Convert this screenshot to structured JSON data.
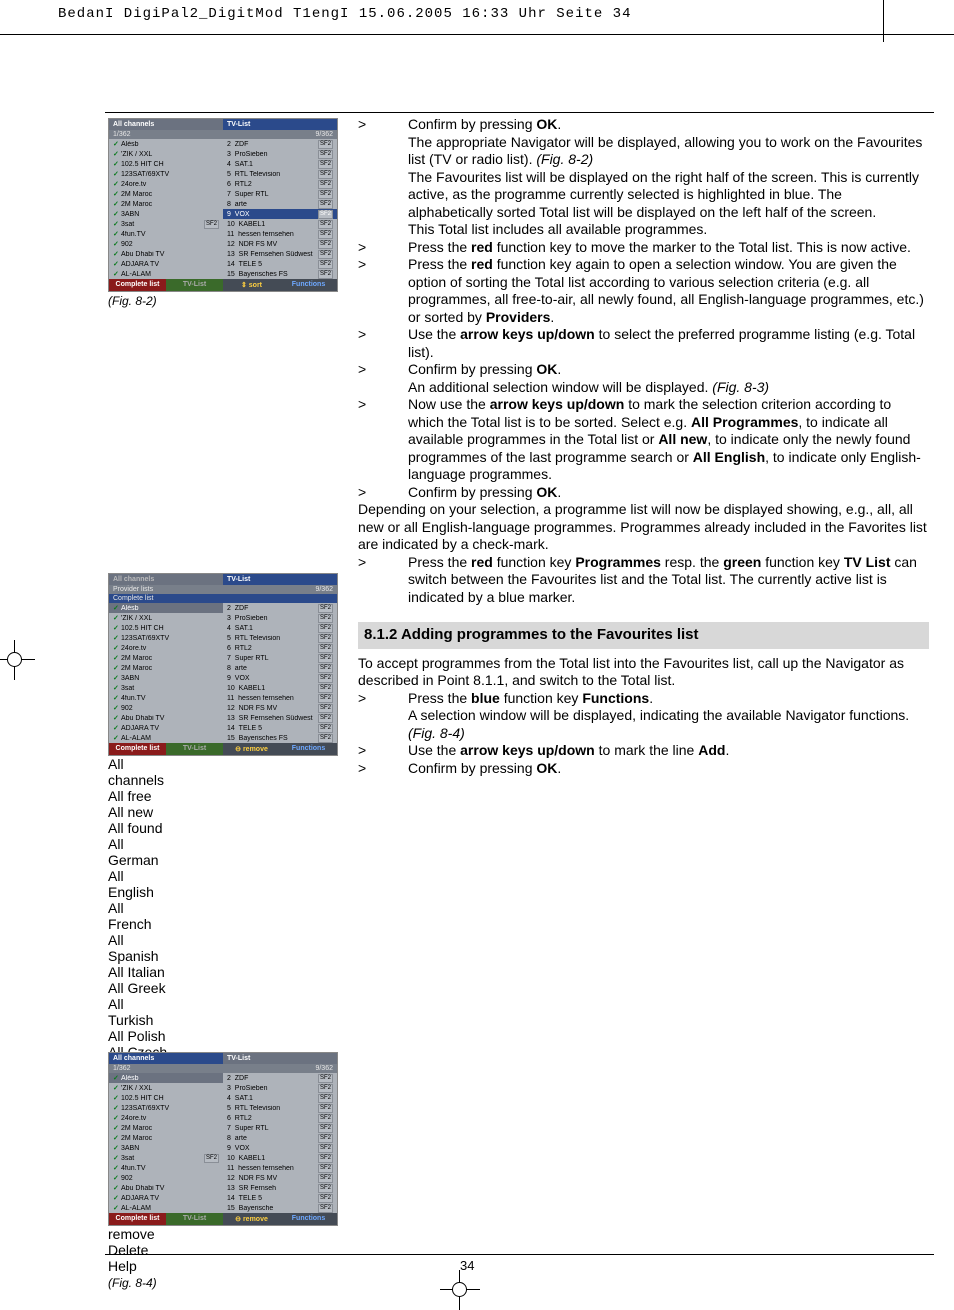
{
  "header": "BedanI DigiPal2_DigitMod T1engI  15.06.2005  16:33 Uhr  Seite 34",
  "pagenum": "34",
  "figs": {
    "a": "(Fig. 8-2)",
    "b": "(Fig. 8-3)",
    "c": "(Fig. 8-4)"
  },
  "shot": {
    "tab_all": "All channels",
    "tab_tv": "TV-List",
    "count_l": "1/362",
    "count_r": "9/362",
    "left": [
      "Alésb",
      "'ZIK / XXL",
      "102.5 HIT CH",
      "123SAT/69XTV",
      "24ore.tv",
      "2M Maroc",
      "2M Maroc",
      "3ABN",
      "3sat",
      "4fun.TV",
      "902",
      "Abu Dhabi TV",
      "ADJARA TV",
      "AL-ALAM"
    ],
    "right_num": [
      "2",
      "3",
      "4",
      "5",
      "6",
      "7",
      "8",
      "9",
      "10",
      "11",
      "12",
      "13",
      "14",
      "15"
    ],
    "right": [
      "ZDF",
      "ProSieben",
      "SAT.1",
      "RTL Television",
      "RTL2",
      "Super RTL",
      "arte",
      "VOX",
      "KABEL1",
      "hessen fernsehen",
      "NDR FS MV",
      "SR Fernsehen Südwest",
      "TELE 5",
      "Bayerisches FS"
    ],
    "right_c": [
      "ZDF",
      "ProSieben",
      "SAT.1",
      "RTL Television",
      "RTL2",
      "Super RTL",
      "arte",
      "VOX",
      "KABEL1",
      "hessen fernsehen",
      "NDR FS MV",
      "SR Fernseh",
      "TELE 5",
      "Bayerische"
    ],
    "foot_complete": "Complete list",
    "foot_tvlist": "TV-List",
    "foot_sort": "⇕ sort",
    "foot_remove": "⊖ remove",
    "foot_func": "Functions",
    "provider": "Provider lists",
    "compl": "Complete list",
    "filter": [
      "All channels",
      "All free",
      "All new",
      "All found",
      "All German",
      "All English",
      "All French",
      "All Spanish",
      "All Italian",
      "All Greek",
      "All Turkish",
      "All Polish",
      "All Czech"
    ],
    "func_menu": [
      "remove",
      "Delete",
      "Help"
    ]
  },
  "body": {
    "p1a": "Confirm by pressing ",
    "p1b": "OK",
    "p1c": ".",
    "p2a": "The appropriate Navigator will be displayed, allowing you to work on the Favourites list (TV or radio list). ",
    "p2b": "(Fig. 8-2)",
    "p3": "The Favourites list will be displayed on the right half of the screen. This is currently active, as the programme currently selected is highlighted in blue. The alphabetically sorted Total list will be displayed on the left half of the screen.",
    "p4": "This Total list includes all available programmes.",
    "p5a": "Press the ",
    "p5b": "red",
    "p5c": " function key to move the marker to the Total list. This is now active.",
    "p6a": "Press the ",
    "p6b": "red",
    "p6c": " function key again to open a selection window. You are given the option of sorting the Total list according to various selection criteria (e.g. all programmes, all free-to-air, all newly found, all English-language programmes, etc.) or sorted by ",
    "p6d": "Providers",
    "p6e": ".",
    "p7a": "Use the ",
    "p7b": "arrow keys up/down",
    "p7c": " to select the preferred programme listing (e.g. Total list).",
    "p8a": "Confirm by pressing ",
    "p8b": "OK",
    "p8c": ".",
    "p9a": "An additional selection window will be displayed. ",
    "p9b": "(Fig. 8-3)",
    "p10a": "Now use the ",
    "p10b": "arrow keys up/down",
    "p10c": " to mark the selection criterion according to which the Total list is to be sorted. Select e.g. ",
    "p10d": "All Programmes",
    "p10e": ", to indicate all available programmes in the Total list or ",
    "p10f": "All new",
    "p10g": ", to indicate only the newly found programmes of the last programme search or ",
    "p10h": "All English",
    "p10i": ", to indicate only English-language programmes.",
    "p11a": "Confirm by pressing ",
    "p11b": "OK",
    "p11c": ".",
    "p12": "Depending on your selection, a programme list will now be displayed showing, e.g., all, all new or all English-language programmes. Programmes already included in the Favorites list are indicated by a check-mark.",
    "p13a": "Press the ",
    "p13b": "red",
    "p13c": " function key ",
    "p13d": "Programmes",
    "p13e": " resp. the ",
    "p13f": "green",
    "p13g": " function key ",
    "p13h": "TV List",
    "p13i": " can switch between the Favourites list and the Total list. The currently active list is indicated by a blue marker.",
    "sect": "8.1.2 Adding programmes to the Favourites list",
    "p14": "To accept programmes from the Total list into the Favourites list, call up the Navigator as described in Point 8.1.1, and switch to the Total list.",
    "p15a": "Press the ",
    "p15b": "blue",
    "p15c": " function key ",
    "p15d": "Functions",
    "p15e": ".",
    "p16a": "A selection window will be displayed, indicating the available Navigator functions. ",
    "p16b": "(Fig. 8-4)",
    "p17a": "Use the ",
    "p17b": "arrow keys up/down",
    "p17c": " to mark the line ",
    "p17d": "Add",
    "p17e": ".",
    "p18a": "Confirm by pressing ",
    "p18b": "OK",
    "p18c": "."
  }
}
